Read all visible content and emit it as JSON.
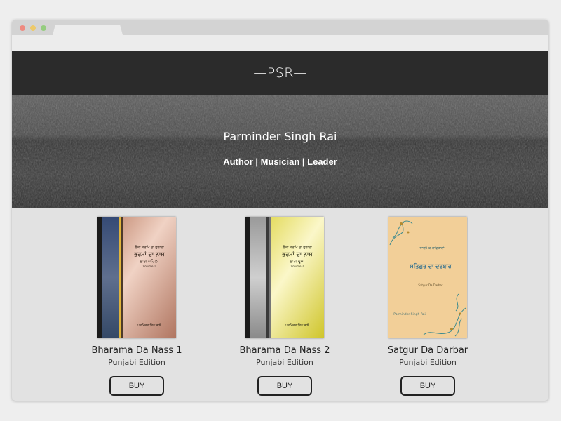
{
  "header": {
    "logo": "—PSR—"
  },
  "hero": {
    "name": "Parminder Singh Rai",
    "tagline": "Author | Musician | Leader"
  },
  "products": [
    {
      "title": "Bharama Da Nass 1",
      "edition": "Punjabi Edition",
      "buy_label": "BUY",
      "cover": {
        "punjabi_top": "ਲੋਕਾ ਕਰਮਿ ਦਾ ਭੁਲਾਵਾ",
        "punjabi_title": "ਭਰਮਾਂ ਦਾ ਨਾਸ",
        "punjabi_sub": "ਭਾਗ ਪਹਿਲਾ",
        "volume": "Volume 1",
        "author_pa": "ਪਰਮਿੰਦਰ ਸਿੰਘ ਰਾਏ",
        "color": "#c98d72"
      }
    },
    {
      "title": "Bharama Da Nass 2",
      "edition": "Punjabi Edition",
      "buy_label": "BUY",
      "cover": {
        "punjabi_top": "ਲੋਕਾ ਕਰਮਿ ਦਾ ਭੁਲਾਵਾ",
        "punjabi_title": "ਭਰਮਾਂ ਦਾ ਨਾਸ",
        "punjabi_sub": "ਭਾਗ ਦੂਜਾ",
        "volume": "Volume 2",
        "author_pa": "ਪਰਮਿੰਦਰ ਸਿੰਘ ਰਾਏ",
        "color": "#e3db45"
      }
    },
    {
      "title": "Satgur Da Darbar",
      "edition": "Punjabi Edition",
      "buy_label": "BUY",
      "cover": {
        "punjabi_top": "ਧਾਰਮਿਕ ਕਵਿਤਾਵਾਂ",
        "punjabi_title": "ਸਤਿਗੁਰ ਦਾ ਦਰਬਾਰ",
        "subtitle": "Satgur Da Darbar",
        "author": "Parminder Singh Rai",
        "color": "#f2cf98"
      }
    }
  ],
  "colors": {
    "topbar": "#2b2b2b",
    "page": "#e2e2e2"
  }
}
